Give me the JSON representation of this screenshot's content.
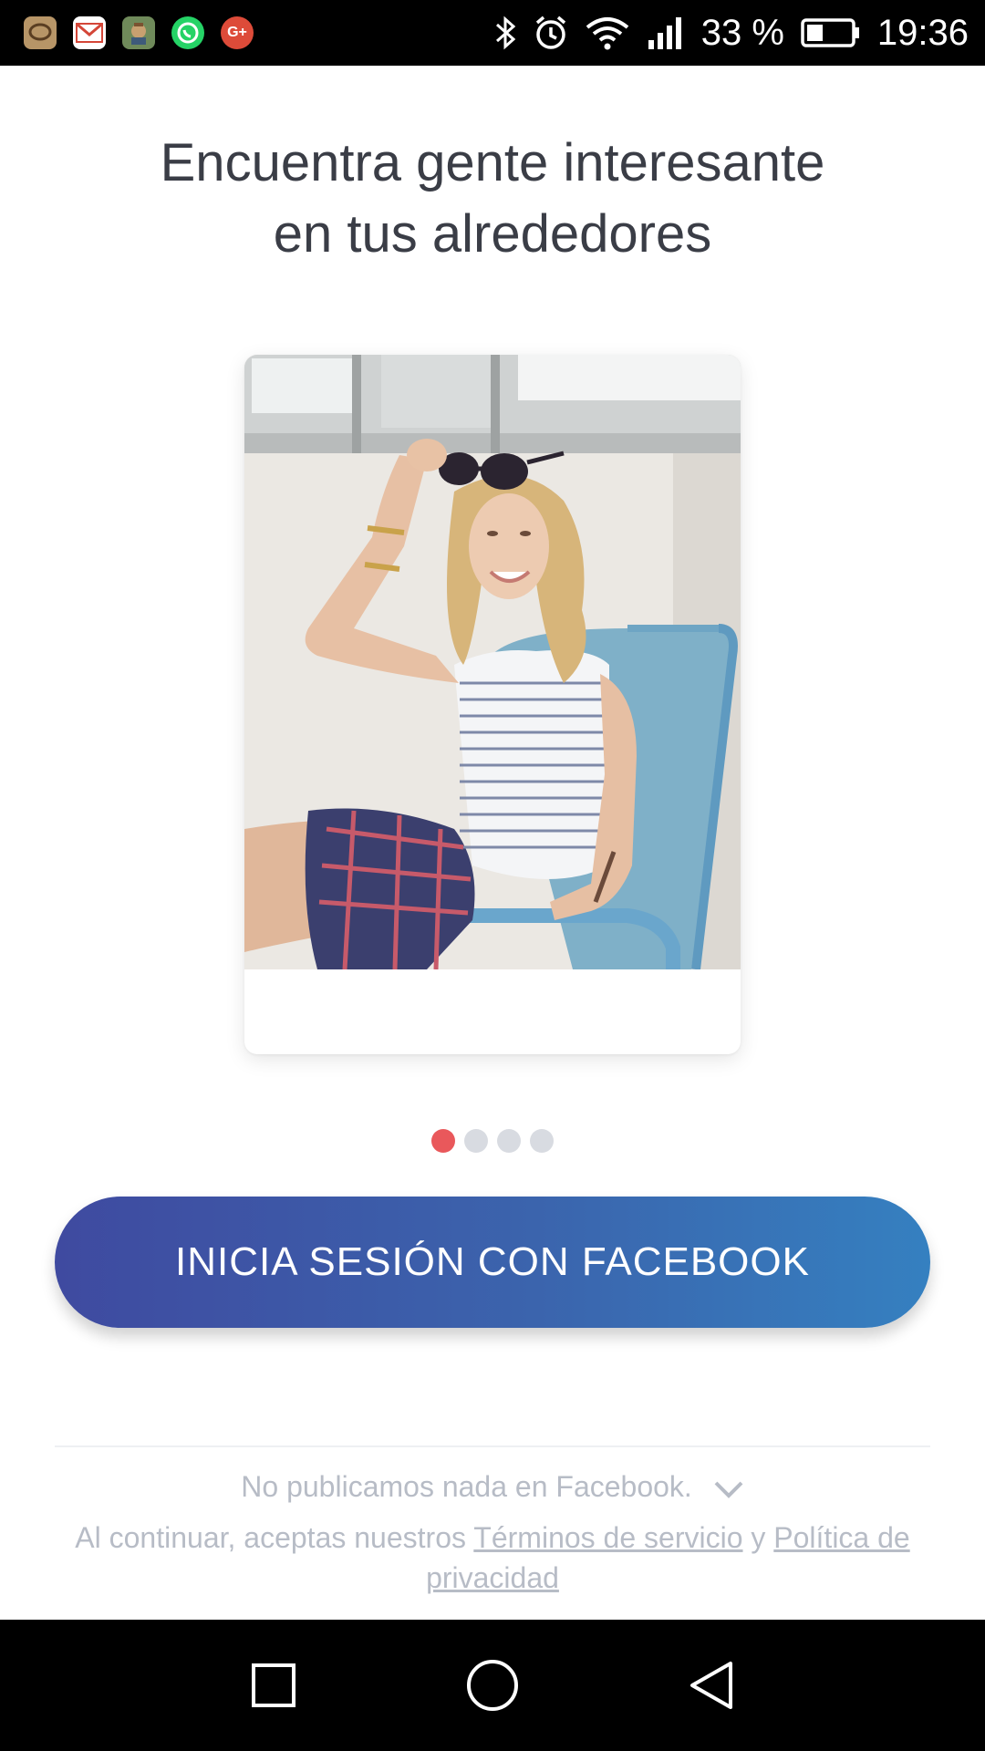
{
  "status_bar": {
    "battery_percent": "33 %",
    "time": "19:36",
    "app_icons": [
      "chat-app-icon",
      "gmail-icon",
      "game-app-icon",
      "whatsapp-icon",
      "google-plus-icon"
    ],
    "gplus_label": "G+"
  },
  "headline": {
    "line1": "Encuentra gente interesante",
    "line2": "en tus alrededores"
  },
  "carousel": {
    "total": 4,
    "active_index": 0
  },
  "login": {
    "facebook_label": "INICIA SESIÓN CON FACEBOOK"
  },
  "footer": {
    "note": "No publicamos nada en Facebook.",
    "legal_prefix": "Al continuar, aceptas nuestros",
    "terms_link": "Términos de servicio",
    "conjunction": "y",
    "privacy_link": "Política de privacidad"
  },
  "colors": {
    "accent_dot": "#e9585b",
    "button_start": "#3f4aa0",
    "button_end": "#3580c0"
  }
}
